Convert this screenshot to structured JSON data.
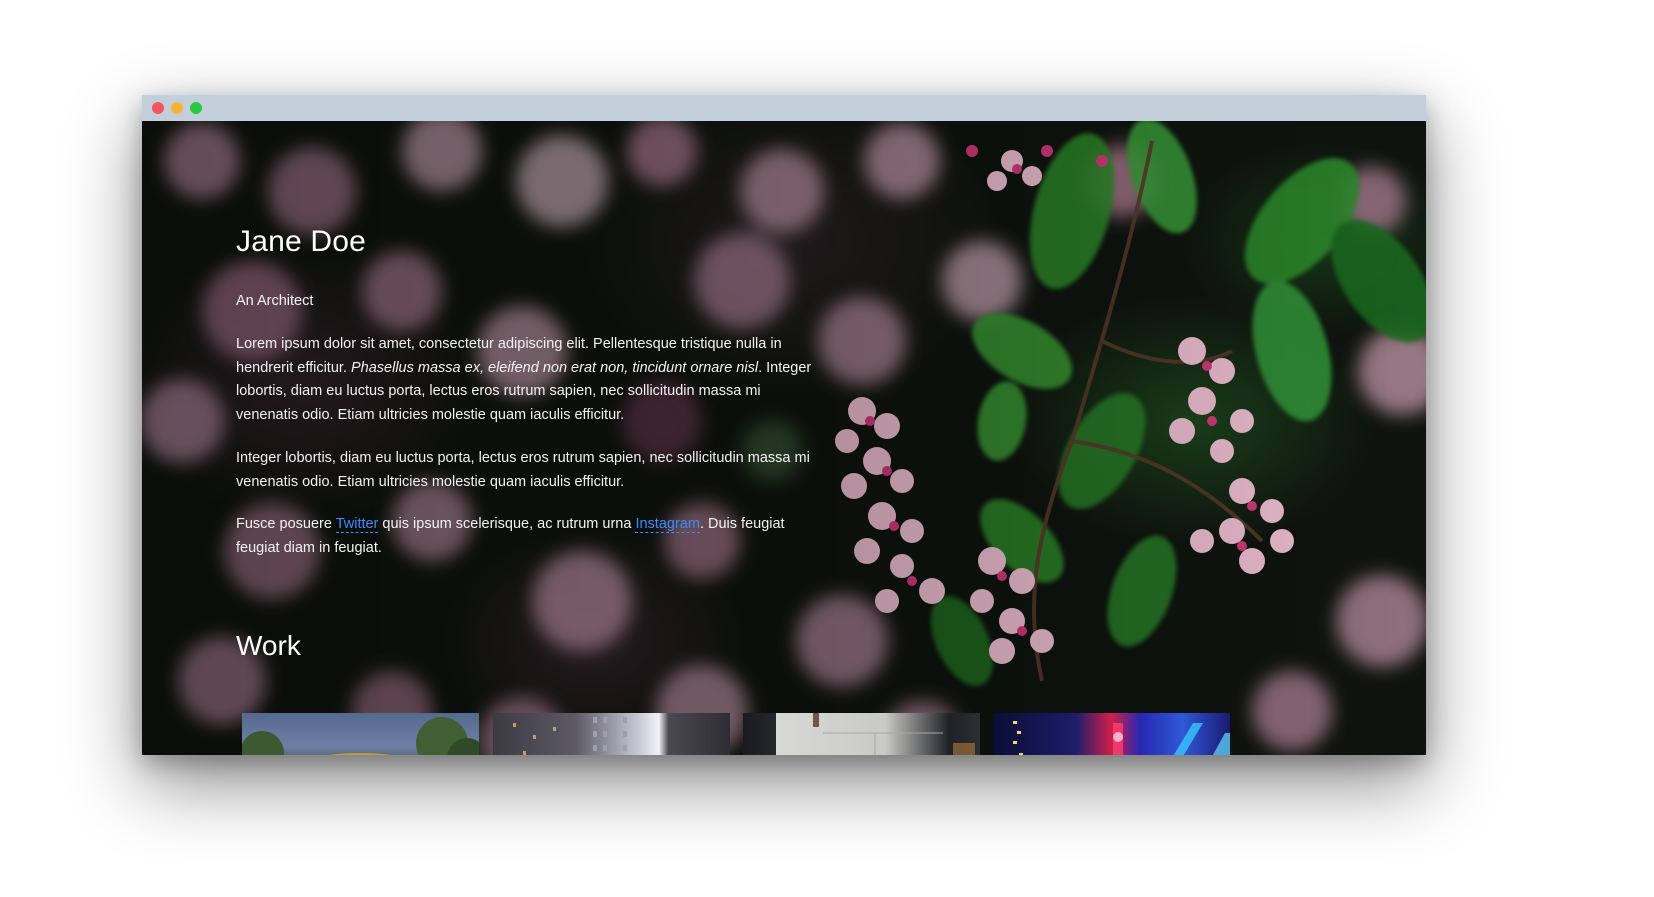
{
  "window": {
    "controls": {
      "close_color": "#f5535f",
      "minimize_color": "#f5b33a",
      "zoom_color": "#28c840"
    }
  },
  "profile": {
    "name": "Jane Doe",
    "role": "An Architect",
    "bio_1_start": "Lorem ipsum dolor sit amet, consectetur adipiscing elit. Pellentesque tristique nulla in hendrerit efficitur. ",
    "bio_1_italic": "Phasellus massa ex, eleifend non erat non, tincidunt ornare nisl",
    "bio_1_end": ". Integer lobortis, diam eu luctus porta, lectus eros rutrum sapien, nec sollicitudin massa mi venenatis odio. Etiam ultricies molestie quam iaculis efficitur.",
    "bio_2": "Integer lobortis, diam eu luctus porta, lectus eros rutrum sapien, nec sollicitudin massa mi venenatis odio. Etiam ultricies molestie quam iaculis efficitur.",
    "bio_3_start": "Fusce posuere ",
    "twitter_label": "Twitter",
    "bio_3_mid": " quis ipsum scelerisque, ac rutrum urna ",
    "instagram_label": "Instagram",
    "bio_3_end": ". Duis feugiat feugiat diam in feugiat.",
    "link_color": "#3b8cff"
  },
  "work": {
    "title": "Work",
    "thumbnails": [
      {
        "subject": "building-with-trees"
      },
      {
        "subject": "apartment-towers"
      },
      {
        "subject": "concrete-interior"
      },
      {
        "subject": "neon-city-night"
      }
    ]
  }
}
